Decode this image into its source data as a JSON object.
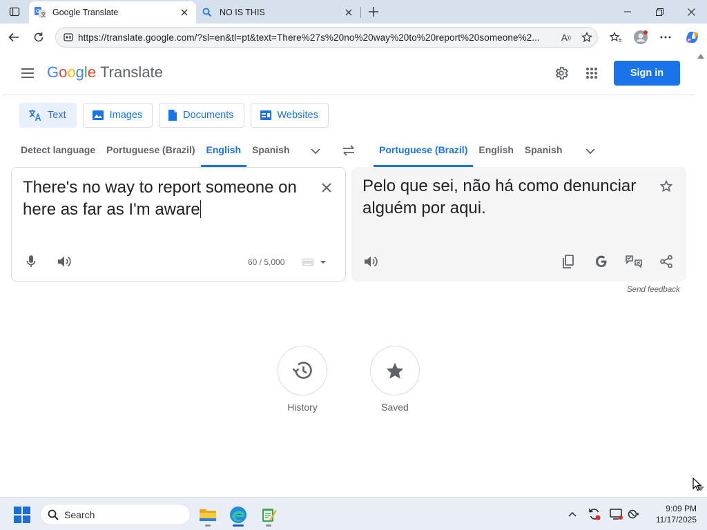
{
  "browser": {
    "tabs": [
      {
        "title": "Google Translate",
        "active": true
      },
      {
        "title": "NO IS THIS",
        "active": false
      }
    ],
    "url": "https://translate.google.com/?sl=en&tl=pt&text=There%27s%20no%20way%20to%20report%20someone%2..."
  },
  "header": {
    "logo": {
      "g1": "G",
      "g2": "o",
      "g3": "o",
      "g4": "g",
      "g5": "l",
      "g6": "e",
      "product": "Translate"
    },
    "sign_in": "Sign in"
  },
  "modes": [
    {
      "label": "Text",
      "icon": "translate-icon",
      "active": true
    },
    {
      "label": "Images",
      "icon": "image-icon",
      "active": false
    },
    {
      "label": "Documents",
      "icon": "document-icon",
      "active": false
    },
    {
      "label": "Websites",
      "icon": "website-icon",
      "active": false
    }
  ],
  "source_langs": [
    {
      "label": "Detect language",
      "selected": false
    },
    {
      "label": "Portuguese (Brazil)",
      "selected": false
    },
    {
      "label": "English",
      "selected": true
    },
    {
      "label": "Spanish",
      "selected": false
    }
  ],
  "target_langs": [
    {
      "label": "Portuguese (Brazil)",
      "selected": true
    },
    {
      "label": "English",
      "selected": false
    },
    {
      "label": "Spanish",
      "selected": false
    }
  ],
  "source": {
    "text": "There's no way to report someone on here as far as I'm aware",
    "char_count": "60 / 5,000"
  },
  "target": {
    "text": "Pelo que sei, não há como denunciar alguém por aqui."
  },
  "feedback": "Send feedback",
  "shortcuts": [
    {
      "label": "History",
      "icon": "history-icon"
    },
    {
      "label": "Saved",
      "icon": "star-icon"
    }
  ],
  "taskbar": {
    "search_label": "Search",
    "time": "9:09 PM",
    "date": "11/17/2025"
  },
  "colors": {
    "accent": "#1a73e8",
    "active_mode_bg": "#e8f0fe",
    "target_box_bg": "#f5f5f5"
  }
}
